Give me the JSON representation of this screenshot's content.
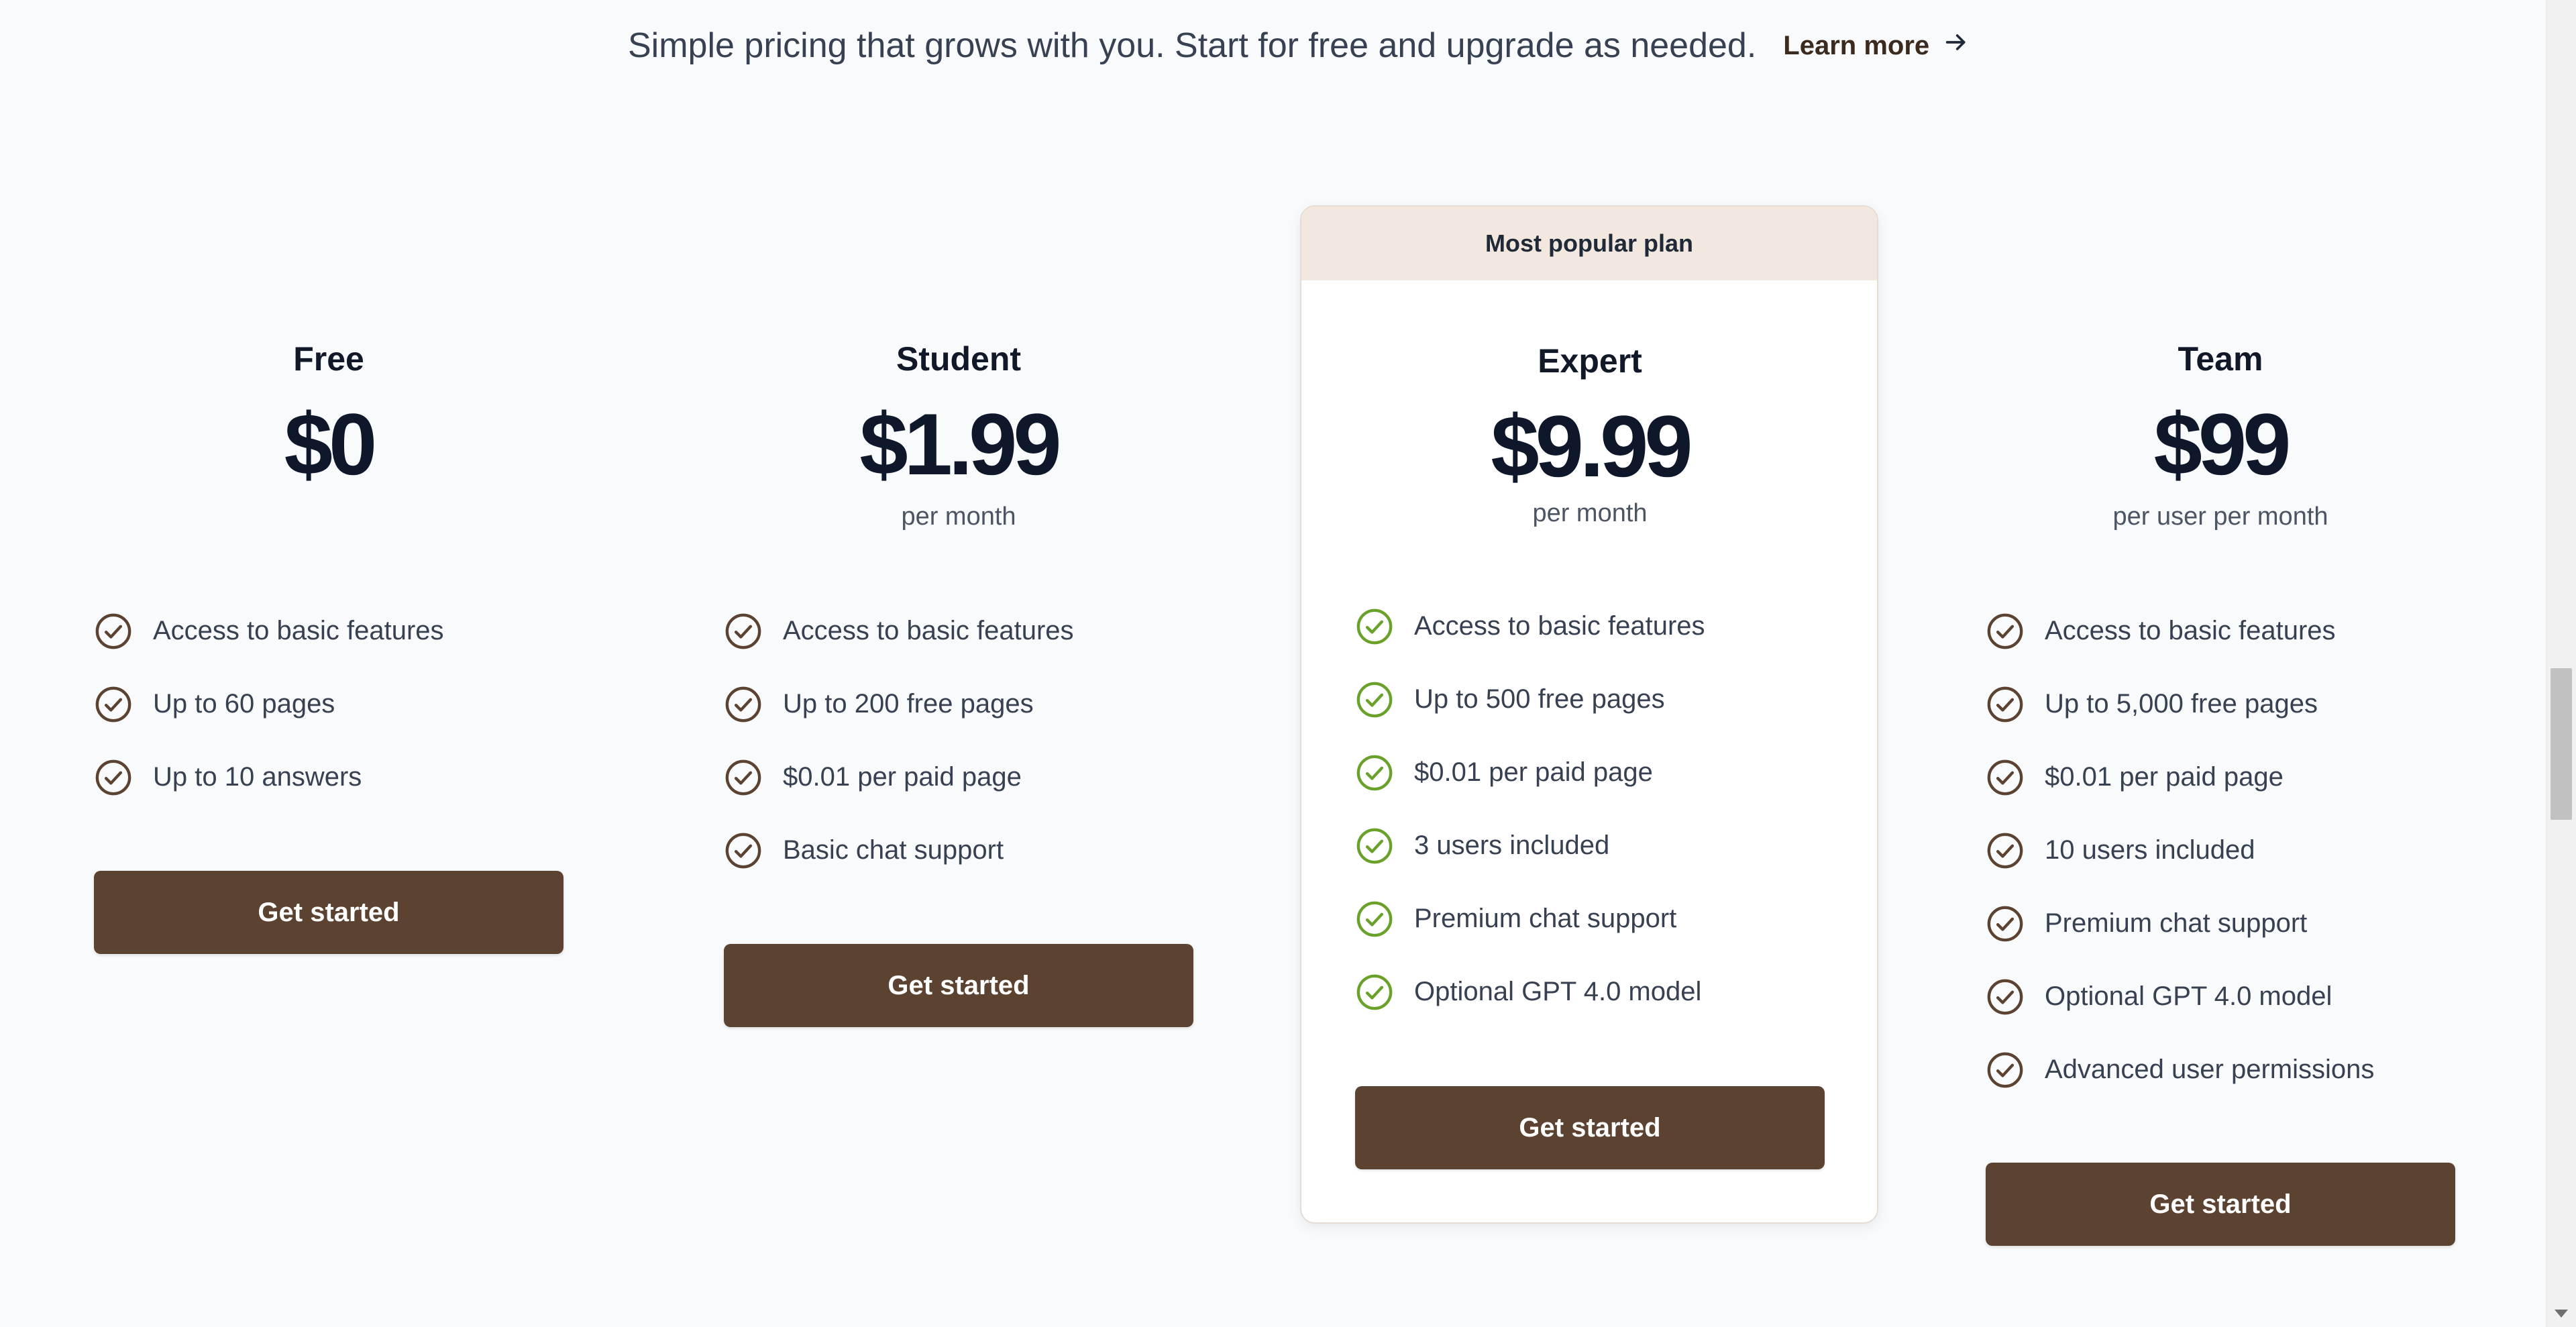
{
  "intro": {
    "text": "Simple pricing that grows with you. Start for free and upgrade as needed.",
    "learn_more": "Learn more",
    "icon": "arrow-right-icon"
  },
  "colors": {
    "button_bg": "#5c4331",
    "check_default": "#5c4331",
    "check_featured": "#6aa12b",
    "banner_bg": "#f3e8df",
    "page_bg": "#f8fafc"
  },
  "plans": {
    "free": {
      "name": "Free",
      "price": "$0",
      "period": "",
      "features": [
        "Access to basic features",
        "Up to 60 pages",
        "Up to 10 answers"
      ],
      "cta": "Get started"
    },
    "student": {
      "name": "Student",
      "price": "$1.99",
      "period": "per month",
      "features": [
        "Access to basic features",
        "Up to 200 free pages",
        "$0.01 per paid page",
        "Basic chat support"
      ],
      "cta": "Get started"
    },
    "expert": {
      "badge": "Most popular plan",
      "name": "Expert",
      "price": "$9.99",
      "period": "per month",
      "features": [
        "Access to basic features",
        "Up to 500 free pages",
        "$0.01 per paid page",
        "3 users included",
        "Premium chat support",
        "Optional GPT 4.0 model"
      ],
      "cta": "Get started"
    },
    "team": {
      "name": "Team",
      "price": "$99",
      "period": "per user per month",
      "features": [
        "Access to basic features",
        "Up to 5,000 free pages",
        "$0.01 per paid page",
        "10 users included",
        "Premium chat support",
        "Optional GPT 4.0 model",
        "Advanced user permissions"
      ],
      "cta": "Get started"
    }
  }
}
